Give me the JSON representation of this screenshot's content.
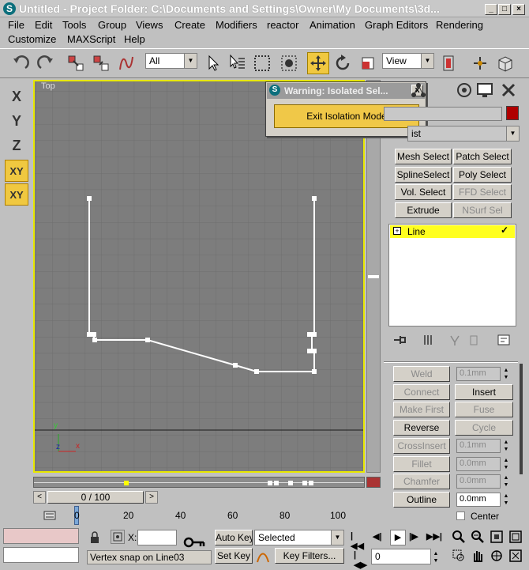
{
  "window": {
    "title": "Untitled      - Project Folder: C:\\Documents and Settings\\Owner\\My Documents\\3d...",
    "app_letter": "S"
  },
  "menu": [
    "File",
    "Edit",
    "Tools",
    "Group",
    "Views",
    "Create",
    "Modifiers",
    "reactor",
    "Animation",
    "Graph Editors",
    "Rendering",
    "Customize",
    "MAXScript",
    "Help"
  ],
  "toolbar": {
    "selection_filter": "All",
    "ref_coord": "View"
  },
  "left_axes": [
    "X",
    "Y",
    "Z",
    "XY",
    "XY"
  ],
  "viewport": {
    "label": "Top",
    "axis_y": "y",
    "axis_z": "z",
    "axis_x": "x"
  },
  "dialog": {
    "title": "Warning: Isolated Sel...",
    "button": "Exit Isolation Mode",
    "close": "x"
  },
  "panel": {
    "list_label": "ist",
    "mod_buttons": [
      "Mesh Select",
      "Patch Select",
      "SplineSelect",
      "Poly Select",
      "Vol. Select",
      "FFD Select",
      "Extrude",
      "NSurf Sel"
    ],
    "stack_item": "Line",
    "weld": "Weld",
    "weld_val": "0.1mm",
    "connect": "Connect",
    "insert": "Insert",
    "make_first": "Make First",
    "fuse": "Fuse",
    "reverse": "Reverse",
    "cycle": "Cycle",
    "crossinsert": "CrossInsert",
    "crossinsert_val": "0.1mm",
    "fillet": "Fillet",
    "fillet_val": "0.0mm",
    "chamfer": "Chamfer",
    "chamfer_val": "0.0mm",
    "outline": "Outline",
    "outline_val": "0.0mm",
    "center": "Center"
  },
  "time": {
    "slider": "0 / 100",
    "ticks": [
      "0",
      "20",
      "40",
      "60",
      "80",
      "100"
    ]
  },
  "bottom": {
    "status": "Vertex snap on Line03",
    "auto_key": "Auto Key",
    "selected": "Selected",
    "set_key": "Set Key",
    "key_filters": "Key Filters...",
    "frame": "0",
    "x_label": "X:"
  }
}
